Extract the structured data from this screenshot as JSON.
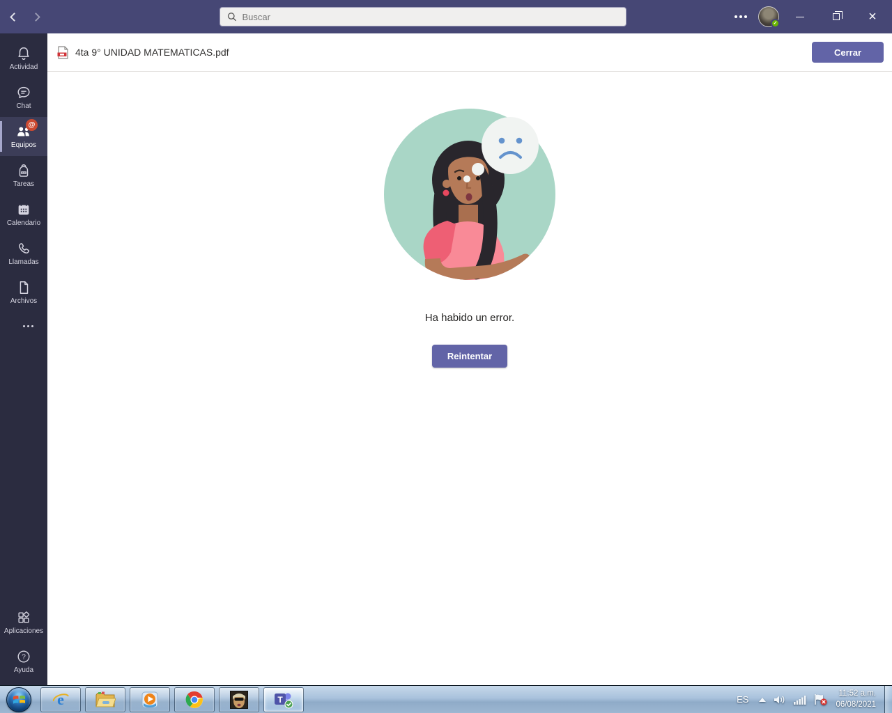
{
  "titlebar": {
    "search_placeholder": "Buscar"
  },
  "sidebar": {
    "items": [
      {
        "label": "Actividad",
        "icon": "bell-icon",
        "active": false
      },
      {
        "label": "Chat",
        "icon": "chat-icon",
        "active": false
      },
      {
        "label": "Equipos",
        "icon": "teams-people-icon",
        "active": true,
        "badge": "@"
      },
      {
        "label": "Tareas",
        "icon": "backpack-icon",
        "active": false
      },
      {
        "label": "Calendario",
        "icon": "calendar-icon",
        "active": false
      },
      {
        "label": "Llamadas",
        "icon": "phone-icon",
        "active": false
      },
      {
        "label": "Archivos",
        "icon": "document-icon",
        "active": false
      }
    ],
    "more_icon": "ellipsis-icon",
    "bottom_items": [
      {
        "label": "Aplicaciones",
        "icon": "apps-grid-icon"
      },
      {
        "label": "Ayuda",
        "icon": "help-circle-icon"
      }
    ]
  },
  "file_viewer": {
    "file_icon": "pdf-file-icon",
    "filename": "4ta 9° UNIDAD MATEMATICAS.pdf",
    "close_button": "Cerrar"
  },
  "error_state": {
    "illustration": "woman-with-sad-thought-bubble",
    "message": "Ha habido un error.",
    "retry_button": "Reintentar"
  },
  "window_controls": {
    "more_icon": "ellipsis-icon",
    "presence_status_icon": "check",
    "presence_glyph": "✓",
    "minimize_icon": "minimize",
    "restore_icon": "restore",
    "close_icon": "close",
    "close_glyph": "×"
  },
  "taskbar": {
    "buttons": [
      "start-orb",
      "internet-explorer",
      "file-explorer",
      "windows-media-player",
      "chrome",
      "photo-viewer",
      "teams"
    ],
    "active_button": "teams",
    "tray": {
      "language": "ES",
      "icons": [
        "hidden-icons-arrow",
        "volume-icon",
        "network-signal-icon",
        "action-center-flag-icon"
      ],
      "time": "11:52 a.m.",
      "date": "06/08/2021"
    }
  },
  "colors": {
    "titlebar_purple": "#464775",
    "sidebar_dark": "#2B2C40",
    "accent_purple": "#6264A7",
    "badge_red": "#CC4A31",
    "illustration_mint": "#A9D6C6",
    "presence_green": "#6BB700",
    "taskbar_glass_blue": "#A9C2DC"
  }
}
